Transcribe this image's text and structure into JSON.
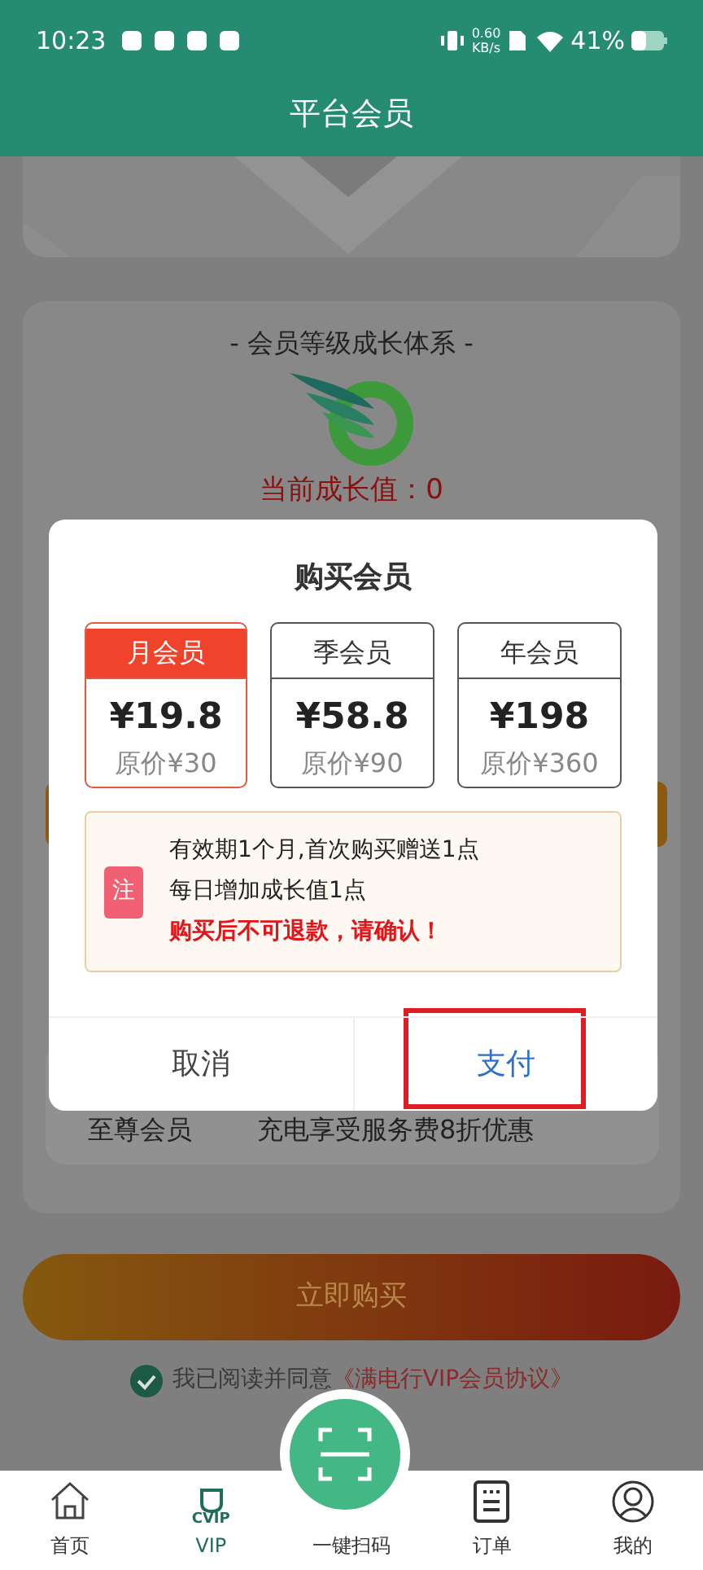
{
  "status_bar": {
    "time": "10:23",
    "net_speed": "0.60",
    "net_unit": "KB/s",
    "battery": "41%"
  },
  "header": {
    "title": "平台会员"
  },
  "growth_card": {
    "title": "- 会员等级成长体系 -",
    "growth_value": "当前成长值：0",
    "benefit_level": "至尊会员",
    "benefit_text": "充电享受服务费8折优惠"
  },
  "buy_button": "立即购买",
  "agreement": {
    "checked": true,
    "text": "我已阅读并同意",
    "link": "《满电行VIP会员协议》"
  },
  "dialog": {
    "title": "购买会员",
    "plans": [
      {
        "name": "月会员",
        "price": "¥19.8",
        "original": "原价¥30",
        "selected": true
      },
      {
        "name": "季会员",
        "price": "¥58.8",
        "original": "原价¥90",
        "selected": false
      },
      {
        "name": "年会员",
        "price": "¥198",
        "original": "原价¥360",
        "selected": false
      }
    ],
    "note_badge": "注",
    "notes": [
      {
        "text": "有效期1个月,首次购买赠送1点",
        "kind": "plain"
      },
      {
        "text": "每日增加成长值1点",
        "kind": "plain"
      },
      {
        "text": "购买后不可退款，请确认！",
        "kind": "warning"
      }
    ],
    "buttons": [
      {
        "label": "取消",
        "kind": "cancel",
        "highlighted": false
      },
      {
        "label": "支付",
        "kind": "confirm",
        "highlighted": true
      }
    ]
  },
  "tab_bar": {
    "items": [
      {
        "label": "首页",
        "kind": "home",
        "selected": false
      },
      {
        "label": "VIP",
        "kind": "vip",
        "icon_text": "CVIP",
        "selected": true
      },
      {
        "label": "一键扫码",
        "kind": "scan",
        "selected": false
      },
      {
        "label": "订单",
        "kind": "orders",
        "selected": false
      },
      {
        "label": "我的",
        "kind": "profile",
        "selected": false
      }
    ]
  }
}
